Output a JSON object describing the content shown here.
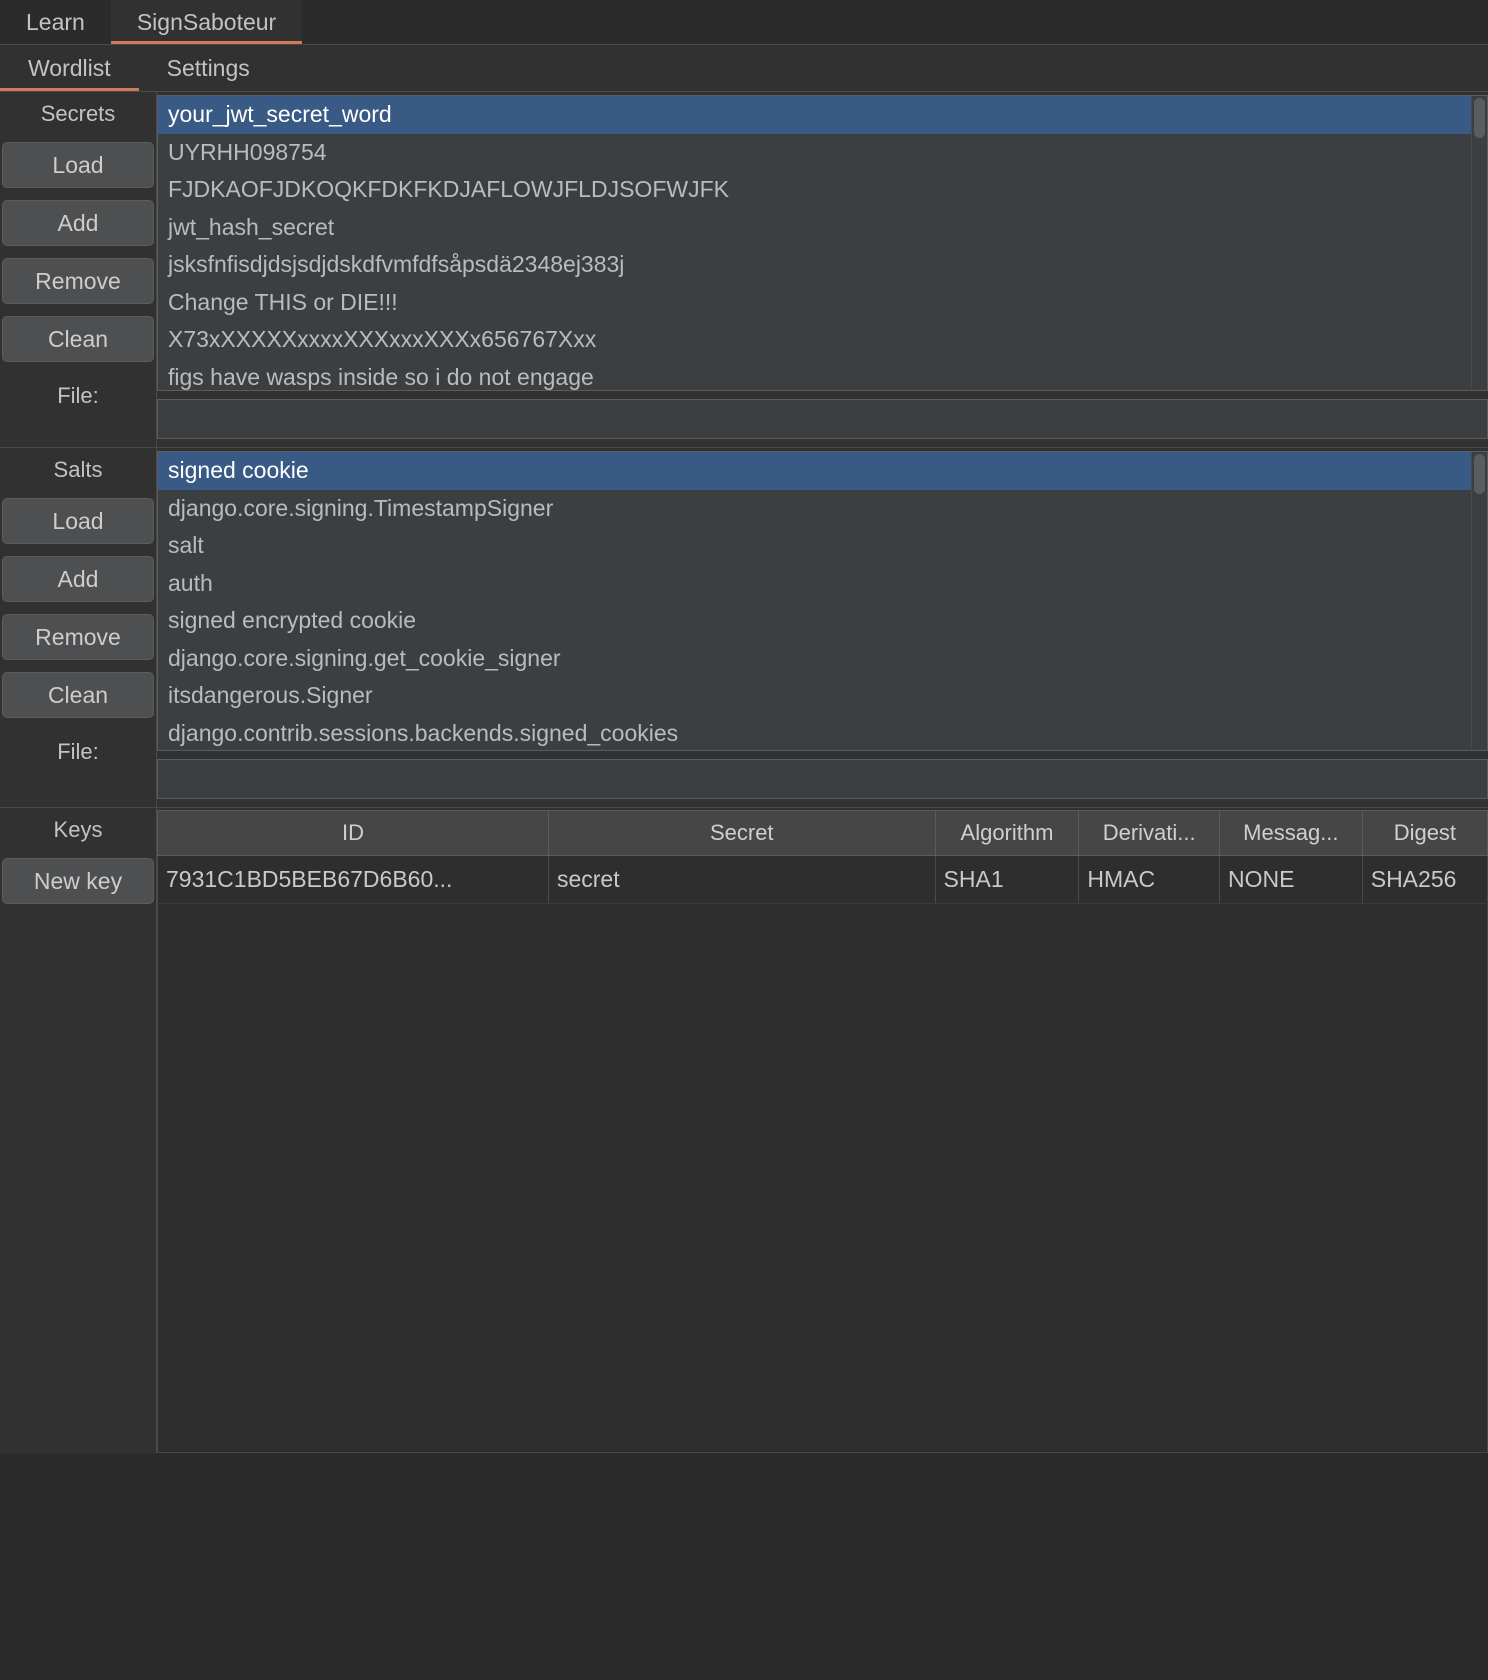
{
  "window": {
    "title": "SignSaboteur"
  },
  "top_tabs": [
    {
      "label": "Learn",
      "active": false
    },
    {
      "label": "SignSaboteur",
      "active": true
    }
  ],
  "sub_tabs": [
    {
      "label": "Wordlist",
      "active": true
    },
    {
      "label": "Settings",
      "active": false
    }
  ],
  "accent_color": "#d2795a",
  "selection_color": "#3a5a86",
  "secrets": {
    "group_label": "Secrets",
    "buttons": [
      {
        "label": "Load",
        "name": "load"
      },
      {
        "label": "Add",
        "name": "add"
      },
      {
        "label": "Remove",
        "name": "remove"
      },
      {
        "label": "Clean",
        "name": "clean"
      }
    ],
    "file_label": "File:",
    "file_value": "",
    "file_placeholder": "",
    "items": [
      {
        "text": "your_jwt_secret_word",
        "selected": true
      },
      {
        "text": "UYRHH098754",
        "selected": false
      },
      {
        "text": "FJDKAOFJDKOQKFDKFKDJAFLOWJFLDJSOFWJFK",
        "selected": false
      },
      {
        "text": "jwt_hash_secret",
        "selected": false
      },
      {
        "text": "jsksfnfisdjdsjsdjdskdfvmfdfsåpsdä2348ej383j",
        "selected": false
      },
      {
        "text": "Change THIS or DIE!!!",
        "selected": false
      },
      {
        "text": "X73xXXXXXxxxxXXXxxxXXXx656767Xxx",
        "selected": false
      },
      {
        "text": "figs have wasps inside so i do not engage",
        "selected": false
      }
    ]
  },
  "salts": {
    "group_label": "Salts",
    "buttons": [
      {
        "label": "Load",
        "name": "load"
      },
      {
        "label": "Add",
        "name": "add"
      },
      {
        "label": "Remove",
        "name": "remove"
      },
      {
        "label": "Clean",
        "name": "clean"
      }
    ],
    "file_label": "File:",
    "file_value": "",
    "file_placeholder": "",
    "items": [
      {
        "text": "signed cookie",
        "selected": true
      },
      {
        "text": "django.core.signing.TimestampSigner",
        "selected": false
      },
      {
        "text": "salt",
        "selected": false
      },
      {
        "text": "auth",
        "selected": false
      },
      {
        "text": "signed encrypted cookie",
        "selected": false
      },
      {
        "text": "django.core.signing.get_cookie_signer",
        "selected": false
      },
      {
        "text": "itsdangerous.Signer",
        "selected": false
      },
      {
        "text": "django.contrib.sessions.backends.signed_cookies",
        "selected": false
      }
    ]
  },
  "keys": {
    "group_label": "Keys",
    "new_key_label": "New key",
    "columns": [
      "ID",
      "Secret",
      "Algorithm",
      "Derivati...",
      "Messag...",
      "Digest"
    ],
    "rows": [
      {
        "id": "7931C1BD5BEB67D6B60...",
        "secret": "secret",
        "algorithm": "SHA1",
        "derivation": "HMAC",
        "message": "NONE",
        "digest": "SHA256"
      }
    ]
  }
}
